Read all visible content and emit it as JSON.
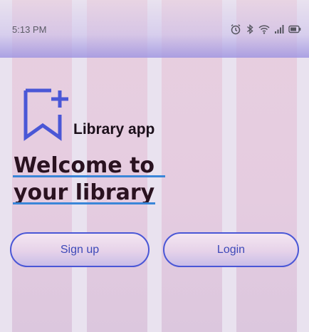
{
  "status_bar": {
    "time": "5:13 PM",
    "icons": [
      "alarm-icon",
      "bluetooth-icon",
      "wifi-icon",
      "signal-icon",
      "battery-icon"
    ]
  },
  "logo": {
    "icon": "bookmark-add-icon",
    "app_name": "Library app"
  },
  "welcome": {
    "line1": "Welcome to",
    "line2": "your library"
  },
  "actions": {
    "signup_label": "Sign up",
    "login_label": "Login"
  },
  "colors": {
    "accent": "#4a57d6",
    "underline": "#3a86d8",
    "heading": "#2a1220"
  }
}
